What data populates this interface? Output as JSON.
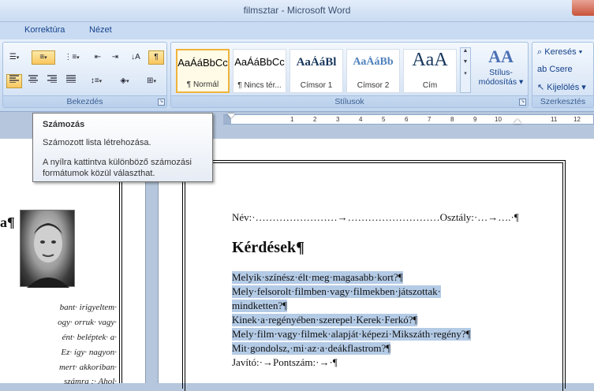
{
  "window": {
    "title": "filmsztar - Microsoft Word"
  },
  "tabs": [
    "Korrektúra",
    "Nézet"
  ],
  "paragraph_group": {
    "label": "Bekezdés",
    "row1": [
      "bullets",
      "numbering",
      "multilevel",
      "decrease-indent",
      "increase-indent",
      "sort",
      "show-formatting"
    ],
    "row2": [
      "align-left",
      "center",
      "align-right",
      "justify",
      "line-spacing",
      "shading",
      "borders"
    ]
  },
  "styles_group": {
    "label": "Stílusok",
    "items": [
      {
        "preview": "AaÁáBbCc",
        "name": "¶ Normál"
      },
      {
        "preview": "AaÁáBbCc",
        "name": "¶ Nincs tér..."
      },
      {
        "preview": "AaÁáBl",
        "name": "Címsor 1"
      },
      {
        "preview": "AaÁáBb",
        "name": "Címsor 2"
      },
      {
        "preview": "AaA",
        "name": "Cím"
      }
    ],
    "change_styles": {
      "icon": "AA",
      "line1": "Stílus-",
      "line2": "módosítás"
    }
  },
  "editing_group": {
    "label": "Szerkesztés",
    "find": "Keresés",
    "replace": "Csere",
    "select": "Kijelölés"
  },
  "ruler": {
    "ticks": [
      "1",
      "2",
      "3",
      "4",
      "5",
      "6",
      "7",
      "8",
      "9",
      "10",
      "11",
      "12"
    ]
  },
  "tooltip": {
    "title": "Számozás",
    "line1": "Számozott lista létrehozása.",
    "line2": "A nyílra kattintva különböző számozási",
    "line3": "formátumok közül választhat."
  },
  "left_page": {
    "heading_frag": "a¶",
    "lines": [
      "bant· irigyeltem·",
      "ogy· orruk· vagy·",
      "ént· beléptek· a·",
      "Ez· így· nagyon·",
      "mert· akkoriban·",
      "számra :· Ahol·"
    ]
  },
  "document": {
    "name_line": "Név:·……………………→………………………Osztály:·…→….·¶",
    "heading": "Kérdések¶",
    "questions": [
      "Melyik·színész·élt·meg·magasabb·kort?¶",
      "Mely·felsorolt·filmben·vagy·filmekben·játszottak·",
      "mindketten?¶",
      "Kinek·a·regényében·szerepel·Kerek·Ferkó?¶",
      "Mely·film·vagy·filmek·alapját·képezi·Mikszáth·regény?¶",
      "Mit·gondolsz,·mi·az·a·deákflastrom?¶"
    ],
    "footer_line": "Javító:·→Pontszám:·→·¶"
  }
}
